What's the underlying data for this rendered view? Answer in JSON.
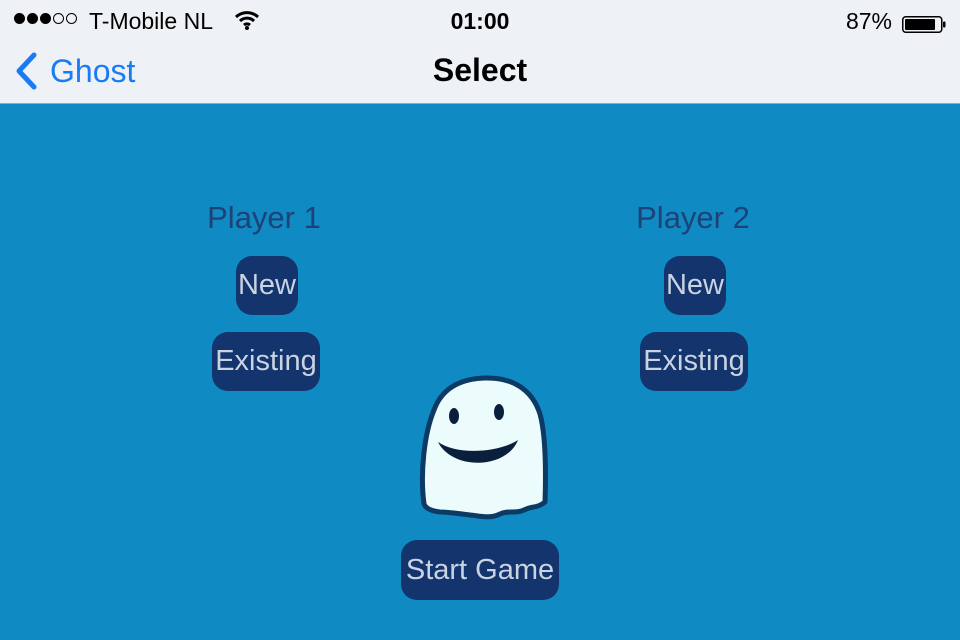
{
  "status_bar": {
    "signal_bars_filled": 3,
    "signal_bars_total": 5,
    "carrier": "T-Mobile NL",
    "time": "01:00",
    "battery_percent": "87%",
    "battery_level": 0.87,
    "wifi_icon": "wifi-icon",
    "battery_icon": "battery-icon"
  },
  "nav": {
    "back_label": "Ghost",
    "back_icon": "chevron-left-icon",
    "title": "Select"
  },
  "players": [
    {
      "label": "Player 1",
      "new_label": "New",
      "existing_label": "Existing"
    },
    {
      "label": "Player 2",
      "new_label": "New",
      "existing_label": "Existing"
    }
  ],
  "start_label": "Start Game",
  "colors": {
    "background": "#108ac2",
    "button": "#13346c",
    "button_text": "#c9d3e2",
    "player_label": "#1e4278",
    "link": "#1a7cf5"
  }
}
